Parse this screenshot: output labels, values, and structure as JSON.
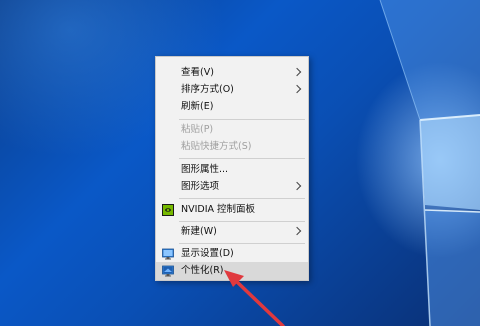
{
  "context_menu": {
    "items": [
      {
        "label": "查看(V)",
        "has_submenu": true,
        "disabled": false
      },
      {
        "label": "排序方式(O)",
        "has_submenu": true,
        "disabled": false
      },
      {
        "label": "刷新(E)",
        "has_submenu": false,
        "disabled": false
      },
      {
        "label": "粘贴(P)",
        "has_submenu": false,
        "disabled": true
      },
      {
        "label": "粘贴快捷方式(S)",
        "has_submenu": false,
        "disabled": true
      },
      {
        "label": "图形属性...",
        "has_submenu": false,
        "disabled": false
      },
      {
        "label": "图形选项",
        "has_submenu": true,
        "disabled": false
      },
      {
        "label": "NVIDIA 控制面板",
        "has_submenu": false,
        "disabled": false,
        "icon": "nvidia-icon"
      },
      {
        "label": "新建(W)",
        "has_submenu": true,
        "disabled": false
      },
      {
        "label": "显示设置(D)",
        "has_submenu": false,
        "disabled": false,
        "icon": "display-icon"
      },
      {
        "label": "个性化(R)",
        "has_submenu": false,
        "disabled": false,
        "icon": "personalize-icon",
        "highlighted": true
      }
    ]
  },
  "colors": {
    "desktop_blue": "#0a58c7",
    "menu_bg": "#f2f2f2",
    "highlight": "#d9d9d9",
    "pointer_red": "#e0393e"
  }
}
